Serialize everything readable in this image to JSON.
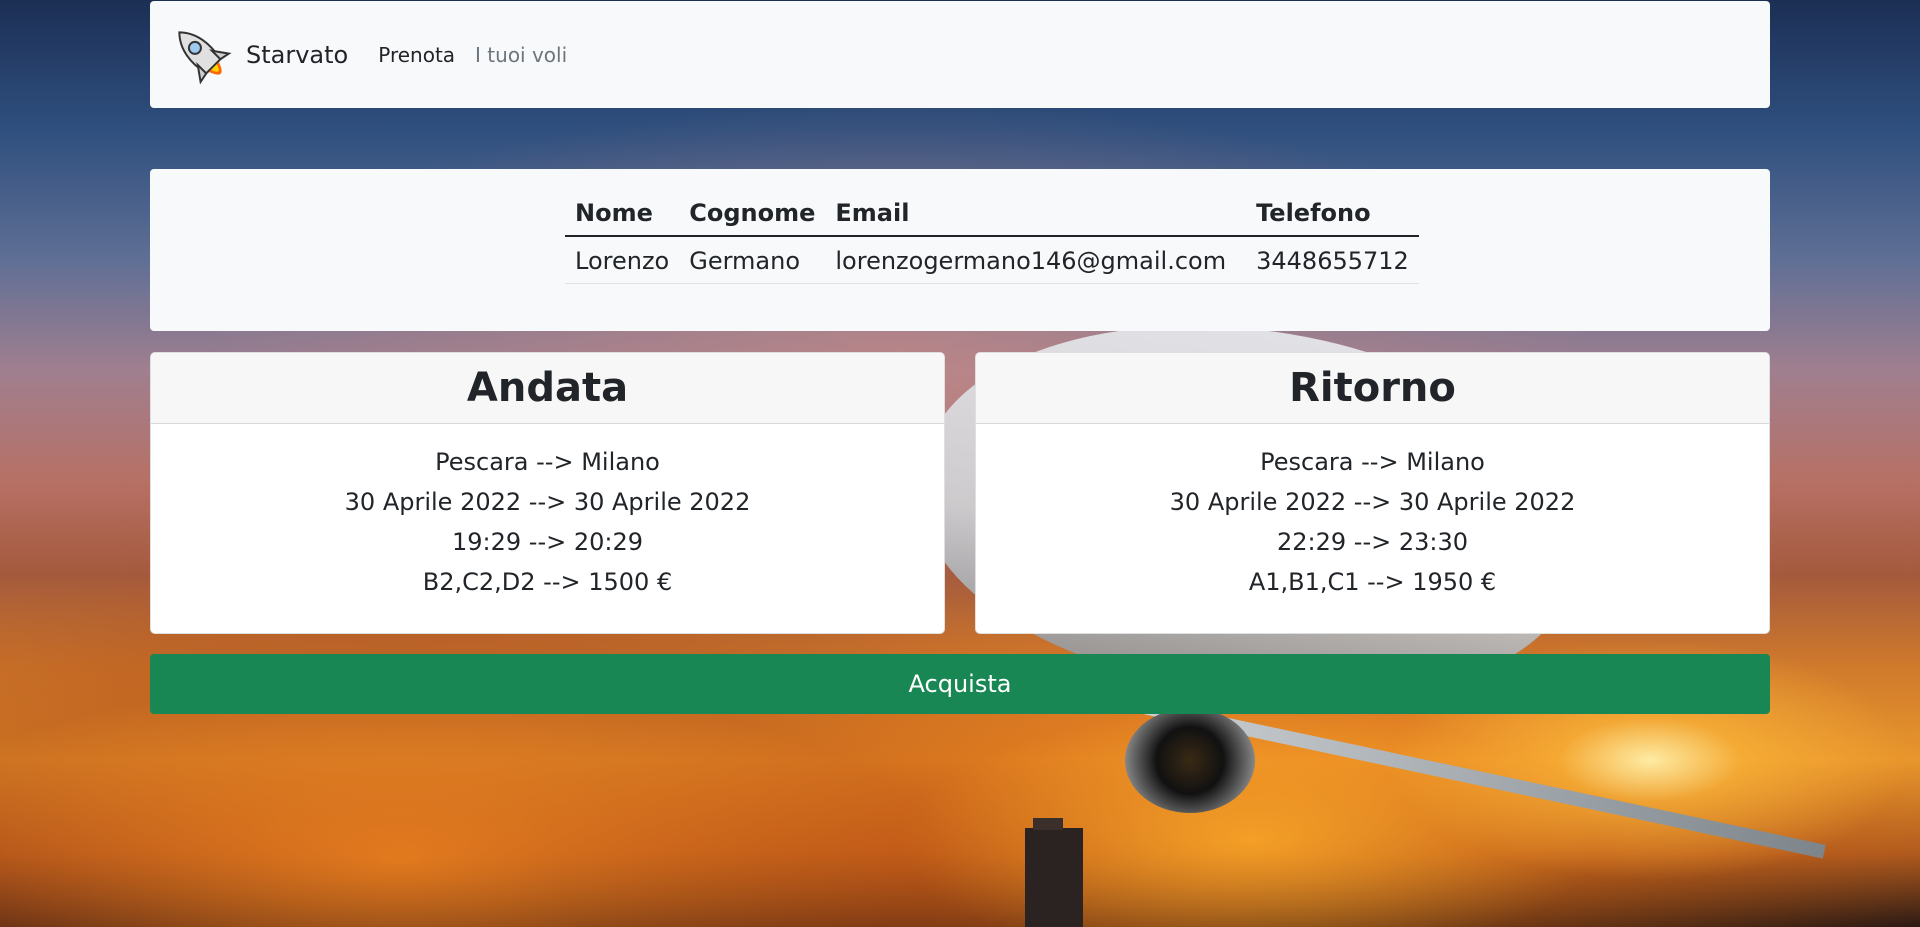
{
  "navbar": {
    "brand": "Starvato",
    "links": [
      {
        "label": "Prenota"
      },
      {
        "label": "I tuoi voli"
      }
    ]
  },
  "user": {
    "headers": [
      "Nome",
      "Cognome",
      "Email",
      "Telefono"
    ],
    "row": [
      "Lorenzo",
      "Germano",
      "lorenzogermano146@gmail.com",
      "3448655712"
    ]
  },
  "outbound": {
    "title": "Andata",
    "route": "Pescara --> Milano",
    "dates": "30 Aprile 2022 --> 30 Aprile 2022",
    "times": "19:29 --> 20:29",
    "seats_price": "B2,C2,D2 --> 1500 €"
  },
  "return": {
    "title": "Ritorno",
    "route": "Pescara --> Milano",
    "dates": "30 Aprile 2022 --> 30 Aprile 2022",
    "times": "22:29 --> 23:30",
    "seats_price": "A1,B1,C1 --> 1950 €"
  },
  "actions": {
    "buy_label": "Acquista"
  },
  "colors": {
    "primary_button": "#198754",
    "panel_background": "#f8f9fa"
  }
}
